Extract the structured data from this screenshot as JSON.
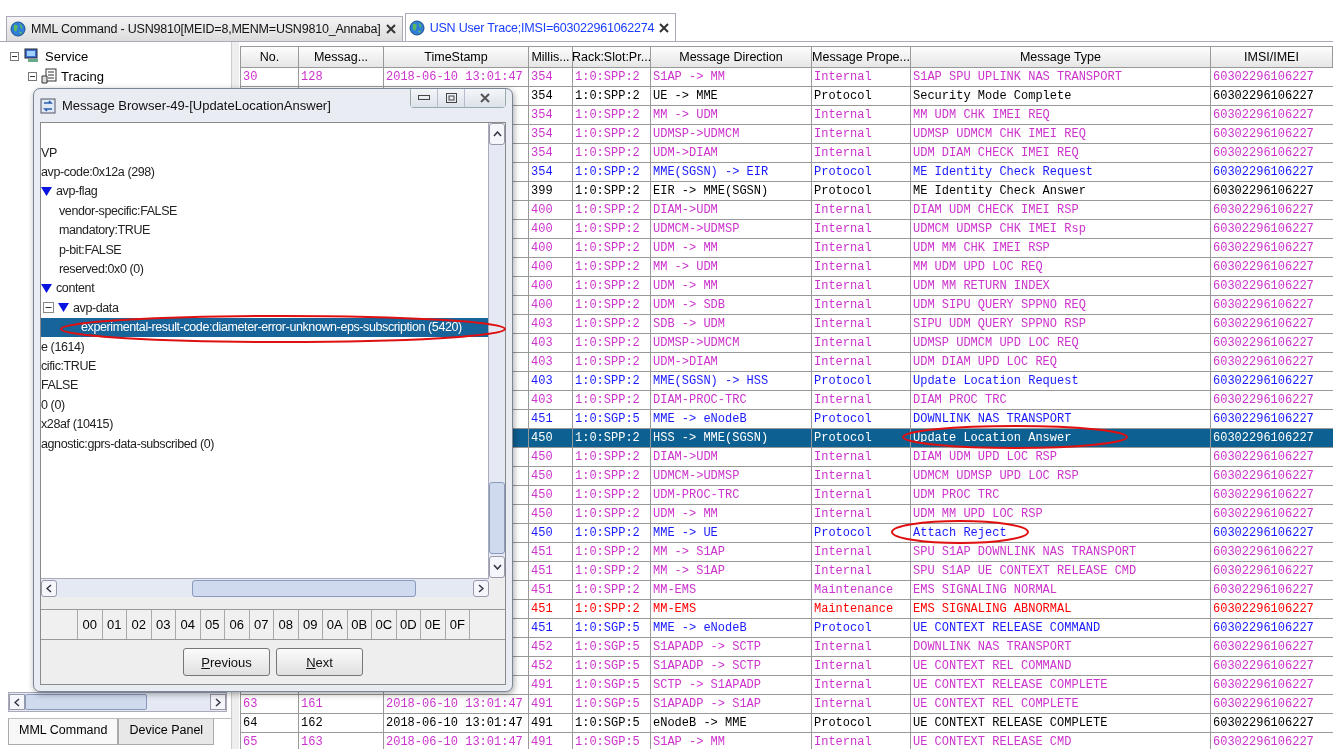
{
  "tabs": [
    {
      "label": "MML Command - USN9810[MEID=8,MENM=USN9810_Annaba]",
      "selected": false
    },
    {
      "label": "USN User Trace;IMSI=603022961062274",
      "selected": true
    }
  ],
  "navigation": {
    "tree": [
      {
        "label": "Service",
        "expanded": true,
        "children": [
          {
            "label": "Tracing",
            "expanded": true
          }
        ]
      }
    ],
    "bottom_tabs": [
      {
        "label": "MML Command",
        "selected": true
      },
      {
        "label": "Device Panel",
        "selected": false
      }
    ]
  },
  "table": {
    "columns": [
      "No.",
      "Messag...",
      "TimeStamp",
      "Millis...",
      "Rack:Slot:Pr...",
      "Message Direction",
      "Message Prope...",
      "Message Type",
      "IMSI/IMEI"
    ],
    "rows": [
      {
        "no": "30",
        "message": "128",
        "timestamp": "2018-06-10 13:01:47",
        "millis": "354",
        "rack": "1:0:SPP:2",
        "direction": "S1AP -> MM",
        "property": "Internal",
        "type": "S1AP SPU UPLINK NAS TRANSPORT",
        "imsi": "60302296106227",
        "color": "#cc33cc",
        "selected": false
      },
      {
        "millis": "354",
        "rack": "1:0:SPP:2",
        "direction": "UE -> MME",
        "property": "Protocol",
        "type": "Security Mode Complete",
        "imsi": "60302296106227",
        "color": "#000000",
        "selected": false
      },
      {
        "millis": "354",
        "rack": "1:0:SPP:2",
        "direction": "MM -> UDM",
        "property": "Internal",
        "type": "MM UDM CHK IMEI REQ",
        "imsi": "60302296106227",
        "color": "#cc33cc",
        "selected": false
      },
      {
        "millis": "354",
        "rack": "1:0:SPP:2",
        "direction": "UDMSP->UDMCM",
        "property": "Internal",
        "type": "UDMSP UDMCM CHK IMEI REQ",
        "imsi": "60302296106227",
        "color": "#cc33cc",
        "selected": false
      },
      {
        "millis": "354",
        "rack": "1:0:SPP:2",
        "direction": "UDM->DIAM",
        "property": "Internal",
        "type": "UDM DIAM CHECK IMEI REQ",
        "imsi": "60302296106227",
        "color": "#cc33cc",
        "selected": false
      },
      {
        "millis": "354",
        "rack": "1:0:SPP:2",
        "direction": "MME(SGSN) -> EIR",
        "property": "Protocol",
        "type": "ME Identity Check Request",
        "imsi": "60302296106227",
        "color": "#1a1aff",
        "selected": false
      },
      {
        "millis": "399",
        "rack": "1:0:SPP:2",
        "direction": "EIR -> MME(SGSN)",
        "property": "Protocol",
        "type": "ME Identity Check Answer",
        "imsi": "60302296106227",
        "color": "#000000",
        "selected": false
      },
      {
        "millis": "400",
        "rack": "1:0:SPP:2",
        "direction": "DIAM->UDM",
        "property": "Internal",
        "type": "DIAM UDM CHECK IMEI RSP",
        "imsi": "60302296106227",
        "color": "#cc33cc",
        "selected": false
      },
      {
        "millis": "400",
        "rack": "1:0:SPP:2",
        "direction": "UDMCM->UDMSP",
        "property": "Internal",
        "type": "UDMCM UDMSP CHK IMEI Rsp",
        "imsi": "60302296106227",
        "color": "#cc33cc",
        "selected": false
      },
      {
        "millis": "400",
        "rack": "1:0:SPP:2",
        "direction": "UDM -> MM",
        "property": "Internal",
        "type": "UDM MM CHK IMEI RSP",
        "imsi": "60302296106227",
        "color": "#cc33cc",
        "selected": false
      },
      {
        "millis": "400",
        "rack": "1:0:SPP:2",
        "direction": "MM -> UDM",
        "property": "Internal",
        "type": "MM UDM UPD LOC REQ",
        "imsi": "60302296106227",
        "color": "#cc33cc",
        "selected": false
      },
      {
        "millis": "400",
        "rack": "1:0:SPP:2",
        "direction": "UDM -> MM",
        "property": "Internal",
        "type": "UDM MM RETURN INDEX",
        "imsi": "60302296106227",
        "color": "#cc33cc",
        "selected": false
      },
      {
        "millis": "400",
        "rack": "1:0:SPP:2",
        "direction": "UDM -> SDB",
        "property": "Internal",
        "type": "UDM SIPU QUERY SPPNO REQ",
        "imsi": "60302296106227",
        "color": "#cc33cc",
        "selected": false
      },
      {
        "millis": "403",
        "rack": "1:0:SPP:2",
        "direction": "SDB -> UDM",
        "property": "Internal",
        "type": "SIPU UDM QUERY SPPNO RSP",
        "imsi": "60302296106227",
        "color": "#cc33cc",
        "selected": false
      },
      {
        "millis": "403",
        "rack": "1:0:SPP:2",
        "direction": "UDMSP->UDMCM",
        "property": "Internal",
        "type": "UDMSP UDMCM UPD LOC REQ",
        "imsi": "60302296106227",
        "color": "#cc33cc",
        "selected": false
      },
      {
        "millis": "403",
        "rack": "1:0:SPP:2",
        "direction": "UDM->DIAM",
        "property": "Internal",
        "type": "UDM DIAM UPD LOC REQ",
        "imsi": "60302296106227",
        "color": "#cc33cc",
        "selected": false
      },
      {
        "millis": "403",
        "rack": "1:0:SPP:2",
        "direction": "MME(SGSN) -> HSS",
        "property": "Protocol",
        "type": "Update Location Request",
        "imsi": "60302296106227",
        "color": "#1a1aff",
        "selected": false
      },
      {
        "millis": "403",
        "rack": "1:0:SPP:2",
        "direction": "DIAM-PROC-TRC",
        "property": "Internal",
        "type": "DIAM PROC TRC",
        "imsi": "60302296106227",
        "color": "#cc33cc",
        "selected": false
      },
      {
        "millis": "451",
        "rack": "1:0:SGP:5",
        "direction": "MME -> eNodeB",
        "property": "Protocol",
        "type": "DOWNLINK NAS TRANSPORT",
        "imsi": "60302296106227",
        "color": "#1a1aff",
        "selected": false
      },
      {
        "millis": "450",
        "rack": "1:0:SPP:2",
        "direction": "HSS -> MME(SGSN)",
        "property": "Protocol",
        "type": "Update Location Answer",
        "imsi": "60302296106227",
        "selected": true
      },
      {
        "millis": "450",
        "rack": "1:0:SPP:2",
        "direction": "DIAM->UDM",
        "property": "Internal",
        "type": "DIAM UDM UPD LOC RSP",
        "imsi": "60302296106227",
        "color": "#cc33cc",
        "selected": false
      },
      {
        "millis": "450",
        "rack": "1:0:SPP:2",
        "direction": "UDMCM->UDMSP",
        "property": "Internal",
        "type": "UDMCM UDMSP UPD LOC RSP",
        "imsi": "60302296106227",
        "color": "#cc33cc",
        "selected": false
      },
      {
        "millis": "450",
        "rack": "1:0:SPP:2",
        "direction": "UDM-PROC-TRC",
        "property": "Internal",
        "type": "UDM PROC TRC",
        "imsi": "60302296106227",
        "color": "#cc33cc",
        "selected": false
      },
      {
        "millis": "450",
        "rack": "1:0:SPP:2",
        "direction": "UDM -> MM",
        "property": "Internal",
        "type": "UDM MM UPD LOC RSP",
        "imsi": "60302296106227",
        "color": "#cc33cc",
        "selected": false
      },
      {
        "millis": "450",
        "rack": "1:0:SPP:2",
        "direction": "MME -> UE",
        "property": "Protocol",
        "type": "Attach Reject",
        "imsi": "60302296106227",
        "color": "#1a1aff",
        "selected": false
      },
      {
        "millis": "451",
        "rack": "1:0:SPP:2",
        "direction": "MM -> S1AP",
        "property": "Internal",
        "type": "SPU S1AP DOWNLINK NAS TRANSPORT",
        "imsi": "60302296106227",
        "color": "#cc33cc",
        "selected": false
      },
      {
        "millis": "451",
        "rack": "1:0:SPP:2",
        "direction": "MM -> S1AP",
        "property": "Internal",
        "type": "SPU S1AP UE CONTEXT RELEASE CMD",
        "imsi": "60302296106227",
        "color": "#cc33cc",
        "selected": false
      },
      {
        "millis": "451",
        "rack": "1:0:SPP:2",
        "direction": "MM-EMS",
        "property": "Maintenance",
        "type": "EMS SIGNALING NORMAL",
        "imsi": "60302296106227",
        "color": "#cc33cc",
        "selected": false
      },
      {
        "millis": "451",
        "rack": "1:0:SPP:2",
        "direction": "MM-EMS",
        "property": "Maintenance",
        "type": "EMS SIGNALING ABNORMAL",
        "imsi": "60302296106227",
        "color": "#ff0000",
        "selected": false
      },
      {
        "millis": "451",
        "rack": "1:0:SGP:5",
        "direction": "MME -> eNodeB",
        "property": "Protocol",
        "type": "UE CONTEXT RELEASE COMMAND",
        "imsi": "60302296106227",
        "color": "#1a1aff",
        "selected": false
      },
      {
        "millis": "452",
        "rack": "1:0:SGP:5",
        "direction": "S1APADP -> SCTP",
        "property": "Internal",
        "type": "DOWNLINK NAS TRANSPORT",
        "imsi": "60302296106227",
        "color": "#cc33cc",
        "selected": false
      },
      {
        "millis": "452",
        "rack": "1:0:SGP:5",
        "direction": "S1APADP -> SCTP",
        "property": "Internal",
        "type": "UE CONTEXT REL COMMAND",
        "imsi": "60302296106227",
        "color": "#cc33cc",
        "selected": false
      },
      {
        "millis": "491",
        "rack": "1:0:SGP:5",
        "direction": "SCTP -> S1APADP",
        "property": "Internal",
        "type": "UE CONTEXT RELEASE COMPLETE",
        "imsi": "60302296106227",
        "color": "#cc33cc",
        "selected": false
      },
      {
        "no": "63",
        "message": "161",
        "timestamp": "2018-06-10 13:01:47",
        "millis": "491",
        "rack": "1:0:SGP:5",
        "direction": "S1APADP -> S1AP",
        "property": "Internal",
        "type": "UE CONTEXT REL COMPLETE",
        "imsi": "60302296106227",
        "color": "#cc33cc",
        "selected": false
      },
      {
        "no": "64",
        "message": "162",
        "timestamp": "2018-06-10 13:01:47",
        "millis": "491",
        "rack": "1:0:SGP:5",
        "direction": "eNodeB -> MME",
        "property": "Protocol",
        "type": "UE CONTEXT RELEASE COMPLETE",
        "imsi": "60302296106227",
        "color": "#000000",
        "selected": false
      },
      {
        "no": "65",
        "message": "163",
        "timestamp": "2018-06-10 13:01:47",
        "millis": "491",
        "rack": "1:0:SGP:5",
        "direction": "S1AP -> MM",
        "property": "Internal",
        "type": "UE CONTEXT RELEASE CMD",
        "imsi": "60302296106227",
        "color": "#cc33cc",
        "selected": false
      }
    ]
  },
  "dialog": {
    "title": "Message Browser-49-[UpdateLocationAnswer]",
    "lines": [
      {
        "text": "VP",
        "selected": false
      },
      {
        "text": "avp-code:0x12a (298)",
        "selected": false
      },
      {
        "text": "avp-flag",
        "selected": false,
        "expanded": true,
        "children": [
          {
            "text": "vendor-specific:FALSE",
            "selected": false
          },
          {
            "text": "mandatory:TRUE",
            "selected": false
          },
          {
            "text": "p-bit:FALSE",
            "selected": false
          },
          {
            "text": "reserved:0x0 (0)",
            "selected": false
          }
        ]
      },
      {
        "text": "content",
        "selected": false,
        "expanded": true,
        "children": [
          {
            "text": "avp-data",
            "selected": false,
            "expanded": true,
            "children": [
              {
                "text": "experimental-result-code:diameter-error-unknown-eps-subscription (5420)",
                "selected": true
              }
            ]
          }
        ]
      },
      {
        "text": "e (1614)",
        "selected": false
      },
      {
        "text": "cific:TRUE",
        "selected": false
      },
      {
        "text": "FALSE",
        "selected": false
      },
      {
        "text": "0 (0)",
        "selected": false
      },
      {
        "text": "x28af (10415)",
        "selected": false
      },
      {
        "text": "agnostic:gprs-data-subscribed (0)",
        "selected": false
      }
    ],
    "hex_columns": [
      "00",
      "01",
      "02",
      "03",
      "04",
      "05",
      "06",
      "07",
      "08",
      "09",
      "0A",
      "0B",
      "0C",
      "0D",
      "0E",
      "0F"
    ],
    "buttons": [
      "Previous",
      "Next"
    ]
  }
}
